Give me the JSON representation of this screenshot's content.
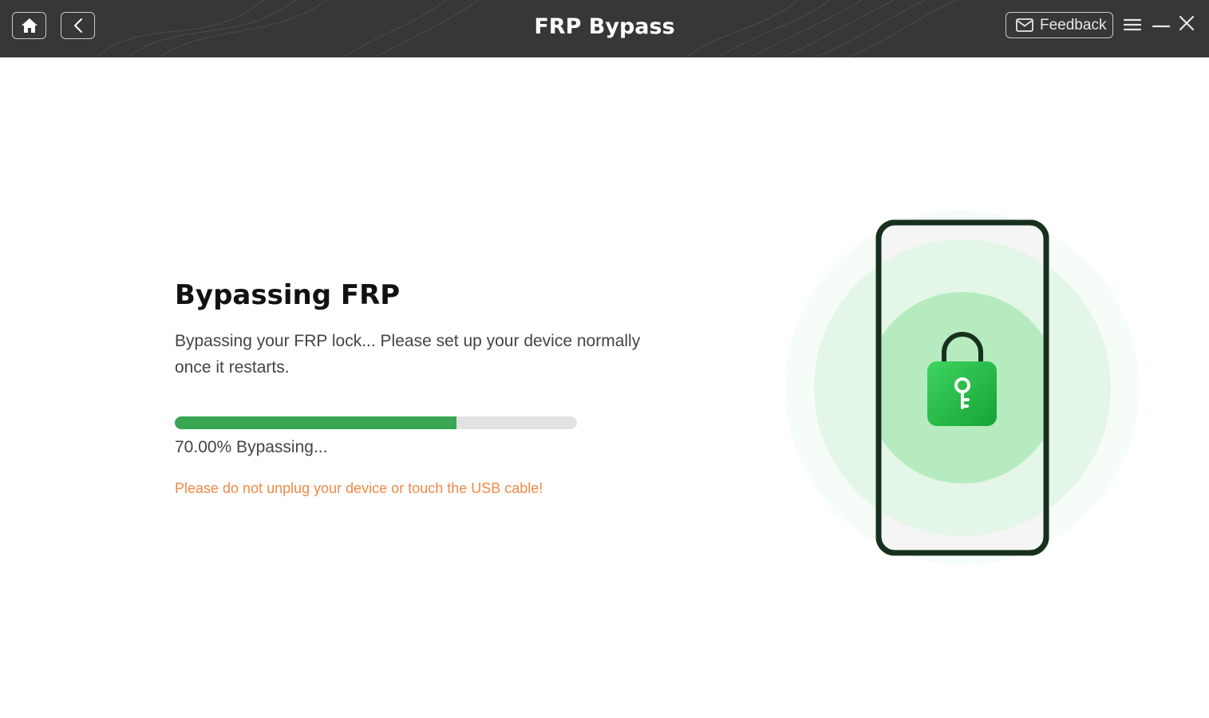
{
  "titlebar": {
    "title": "FRP Bypass",
    "feedback_label": "Feedback",
    "background_color": "#353837"
  },
  "main": {
    "heading": "Bypassing FRP",
    "description": "Bypassing your FRP lock... Please set up your device normally once it restarts.",
    "progress": {
      "percent": 70,
      "text": "70.00% Bypassing...",
      "fill_color": "#3aa553",
      "track_color": "#e2e2e2"
    },
    "warning": "Please do not unplug your device or touch the USB cable!",
    "warning_color": "#f08a48"
  },
  "illustration": {
    "icons": [
      "phone-icon",
      "padlock-icon",
      "key-icon"
    ],
    "accent_color": "#22c04a"
  }
}
